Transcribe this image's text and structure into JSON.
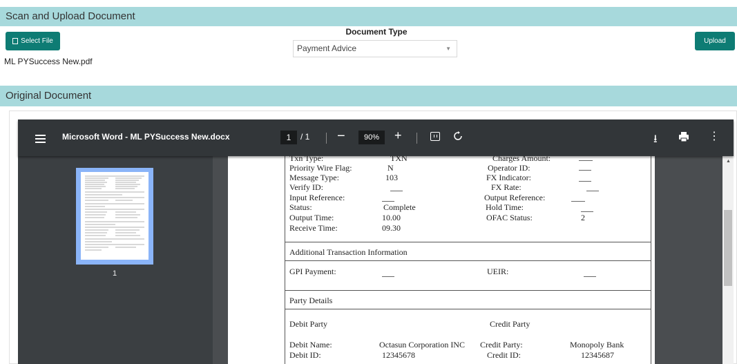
{
  "header": {
    "title": "Scan and Upload Document"
  },
  "select_file": {
    "label": "Select File"
  },
  "file": {
    "name": "ML PYSuccess New.pdf"
  },
  "document_type": {
    "label": "Document Type",
    "selected": "Payment Advice"
  },
  "upload": {
    "label": "Upload"
  },
  "original": {
    "title": "Original Document"
  },
  "viewer": {
    "title": "Microsoft Word - ML PYSuccess New.docx",
    "page_current": "1",
    "page_total": "/ 1",
    "zoom": "90%",
    "thumbnail_label": "1"
  },
  "doc": {
    "txn_type_label": "Txn Type:",
    "txn_type_value": "TXN",
    "charges_label": "Charges Amount:",
    "priority_label": "Priority Wire Flag:",
    "priority_value": "N",
    "operator_label": "Operator ID:",
    "message_type_label": "Message Type:",
    "message_type_value": "103",
    "fx_indicator_label": "FX Indicator:",
    "verify_label": "Verify ID:",
    "fx_rate_label": "FX Rate:",
    "input_ref_label": "Input Reference:",
    "output_ref_label": "Output Reference:",
    "status_label": "Status:",
    "status_value": "Complete",
    "hold_time_label": "Hold Time:",
    "output_time_label": "Output Time:",
    "output_time_value": "10.00",
    "ofac_label": "OFAC Status:",
    "ofac_value": "2",
    "receive_time_label": "Receive Time:",
    "receive_time_value": "09.30",
    "additional_header": "Additional Transaction Information",
    "gpi_label": "GPI Payment:",
    "ueir_label": "UEIR:",
    "party_header": "Party Details",
    "debit_party_label": "Debit Party",
    "credit_party_label": "Credit Party",
    "debit_name_label": "Debit Name:",
    "debit_name_value": "Octasun Corporation INC",
    "credit_party_field_label": "Credit Party:",
    "credit_party_field_value": "Monopoly Bank",
    "debit_id_label": "Debit ID:",
    "debit_id_value": "12345678",
    "credit_id_label": "Credit ID:",
    "credit_id_value": "12345687"
  }
}
